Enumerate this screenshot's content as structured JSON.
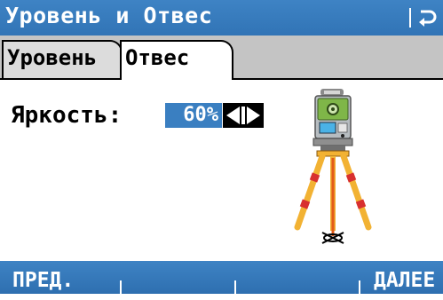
{
  "title": "Уровень и Отвес",
  "tabs": [
    {
      "label": "Уровень",
      "active": false
    },
    {
      "label": "Отвес",
      "active": true
    }
  ],
  "brightness": {
    "label": "Яркость:",
    "value": "60%"
  },
  "softkeys": {
    "f1": "ПРЕД.",
    "f2": "",
    "f3": "",
    "f4": "",
    "f5": "ДАЛЕЕ"
  },
  "colors": {
    "accent": "#3a7fc1",
    "tripod_leg": "#f2b233",
    "tripod_band": "#d8302f",
    "plumb_laser": "#e35b1a"
  },
  "icons": {
    "escape": "return-arrow-icon",
    "adjust": "left-right-arrows-icon",
    "illustration": "total-station-on-tripod-icon"
  }
}
